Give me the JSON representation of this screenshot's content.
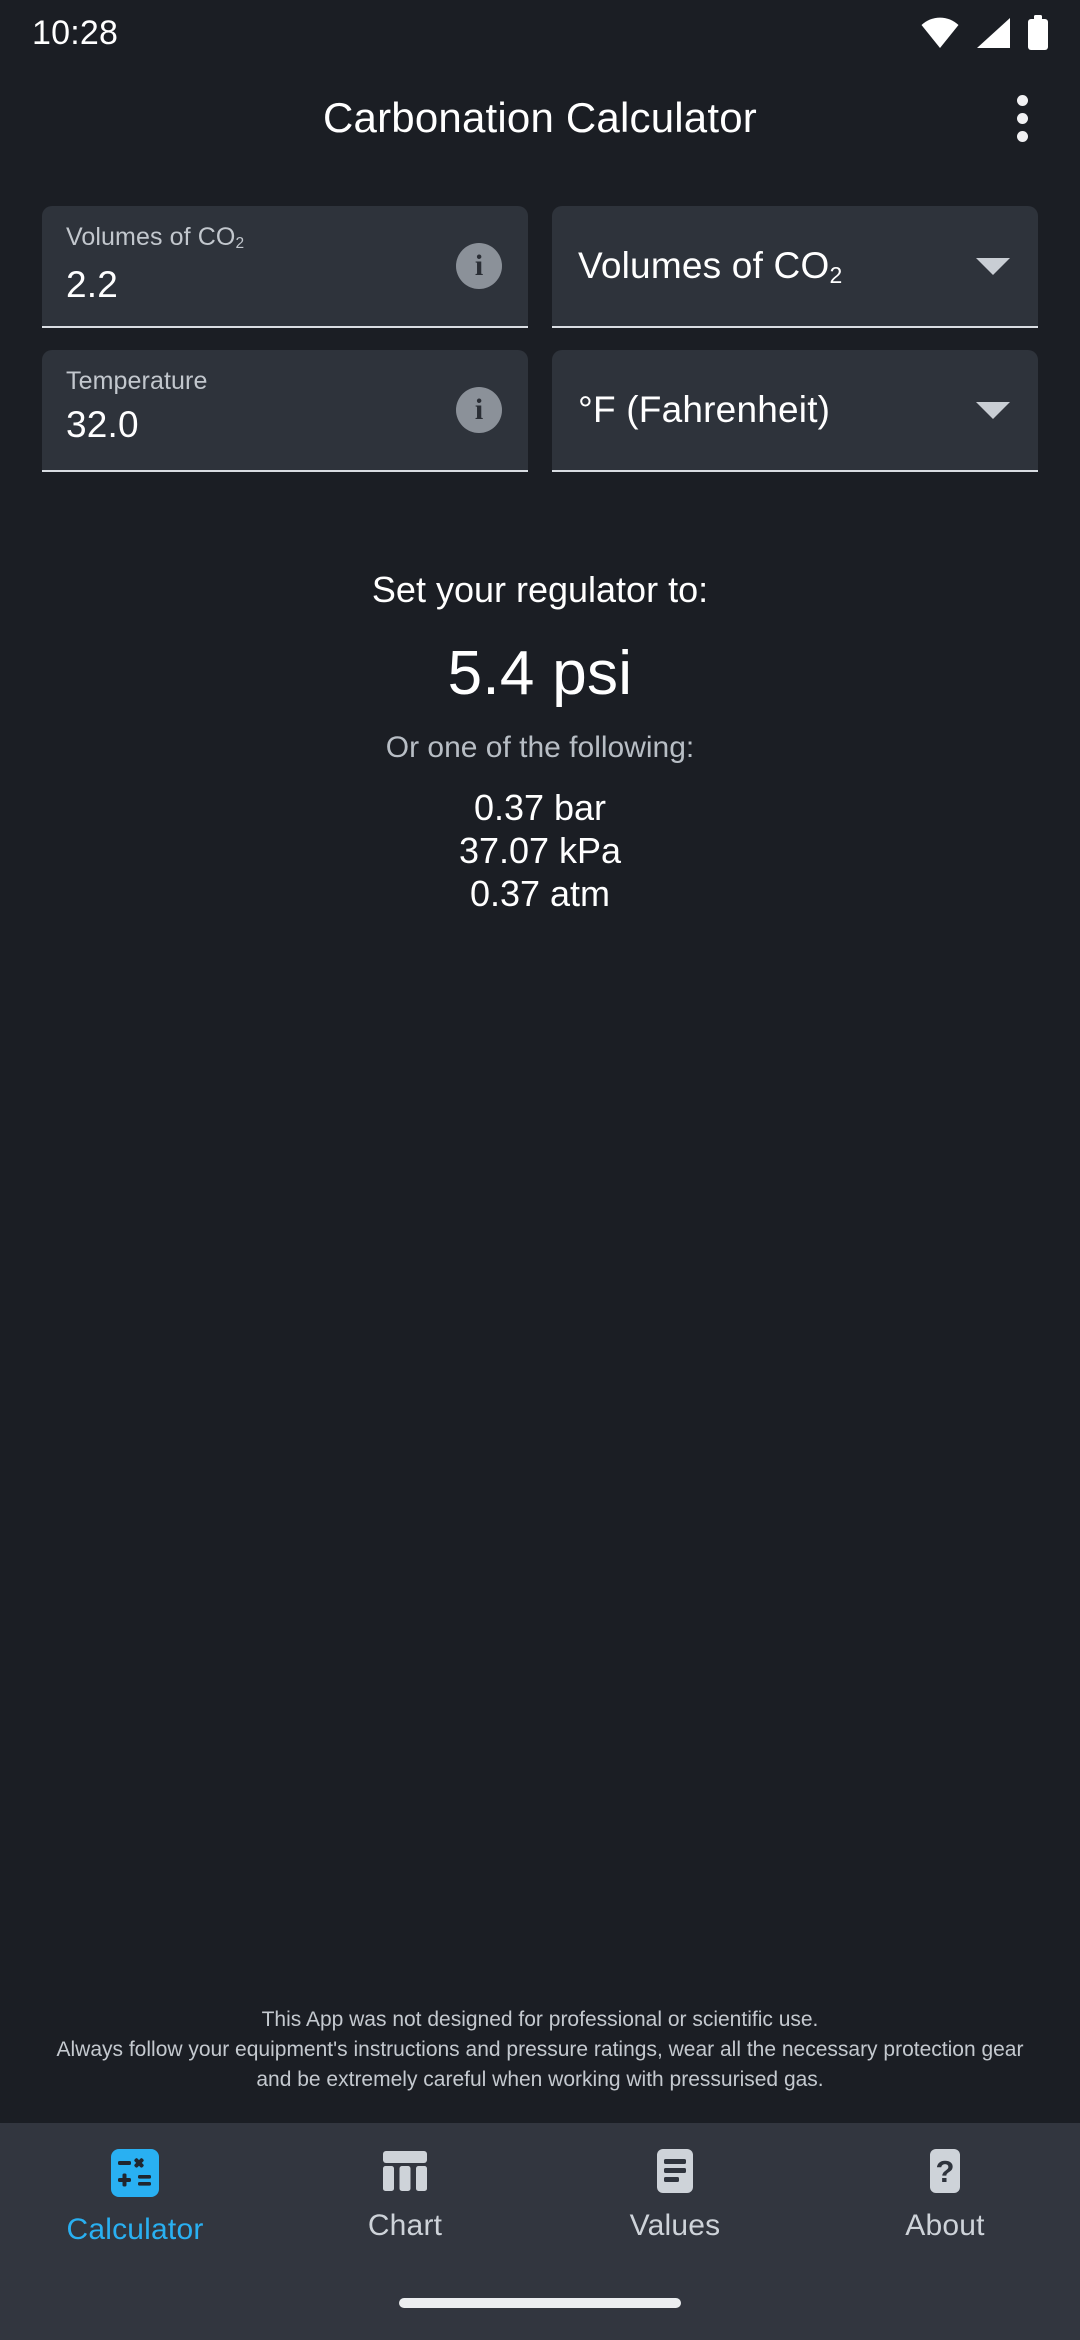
{
  "status_bar": {
    "time": "10:28",
    "icons": [
      "wifi-icon",
      "cellular-signal-icon",
      "battery-icon"
    ]
  },
  "app_bar": {
    "title": "Carbonation Calculator",
    "overflow_menu": "more-options"
  },
  "form": {
    "volumes_field": {
      "label_prefix": "Volumes of CO",
      "label_sub": "2",
      "value": "2.2",
      "info": "i"
    },
    "volumes_unit_dropdown": {
      "selected_prefix": "Volumes of CO",
      "selected_sub": "2"
    },
    "temperature_field": {
      "label": "Temperature",
      "value": "32.0",
      "info": "i"
    },
    "temperature_unit_dropdown": {
      "selected": "°F (Fahrenheit)"
    }
  },
  "result": {
    "prompt": "Set your regulator to:",
    "primary": "5.4 psi",
    "alternatives_label": "Or one of the following:",
    "alternatives": [
      "0.37 bar",
      "37.07 kPa",
      "0.37 atm"
    ]
  },
  "disclaimer": {
    "line1": "This App was not designed for professional or scientific use.",
    "line2": "Always follow your equipment's instructions and pressure ratings, wear all the necessary protection gear",
    "line3": "and be extremely careful when working with pressurised gas."
  },
  "bottom_nav": {
    "items": [
      {
        "label": "Calculator",
        "icon": "calculator-icon",
        "active": true
      },
      {
        "label": "Chart",
        "icon": "chart-icon",
        "active": false
      },
      {
        "label": "Values",
        "icon": "list-icon",
        "active": false
      },
      {
        "label": "About",
        "icon": "question-mark-icon",
        "active": false
      }
    ]
  },
  "colors": {
    "background": "#1b1e24",
    "field_fill": "#2e333b",
    "nav_background": "#32363f",
    "accent": "#29b0f2",
    "text_primary": "#ffffff",
    "text_secondary": "#c2c7cd"
  }
}
